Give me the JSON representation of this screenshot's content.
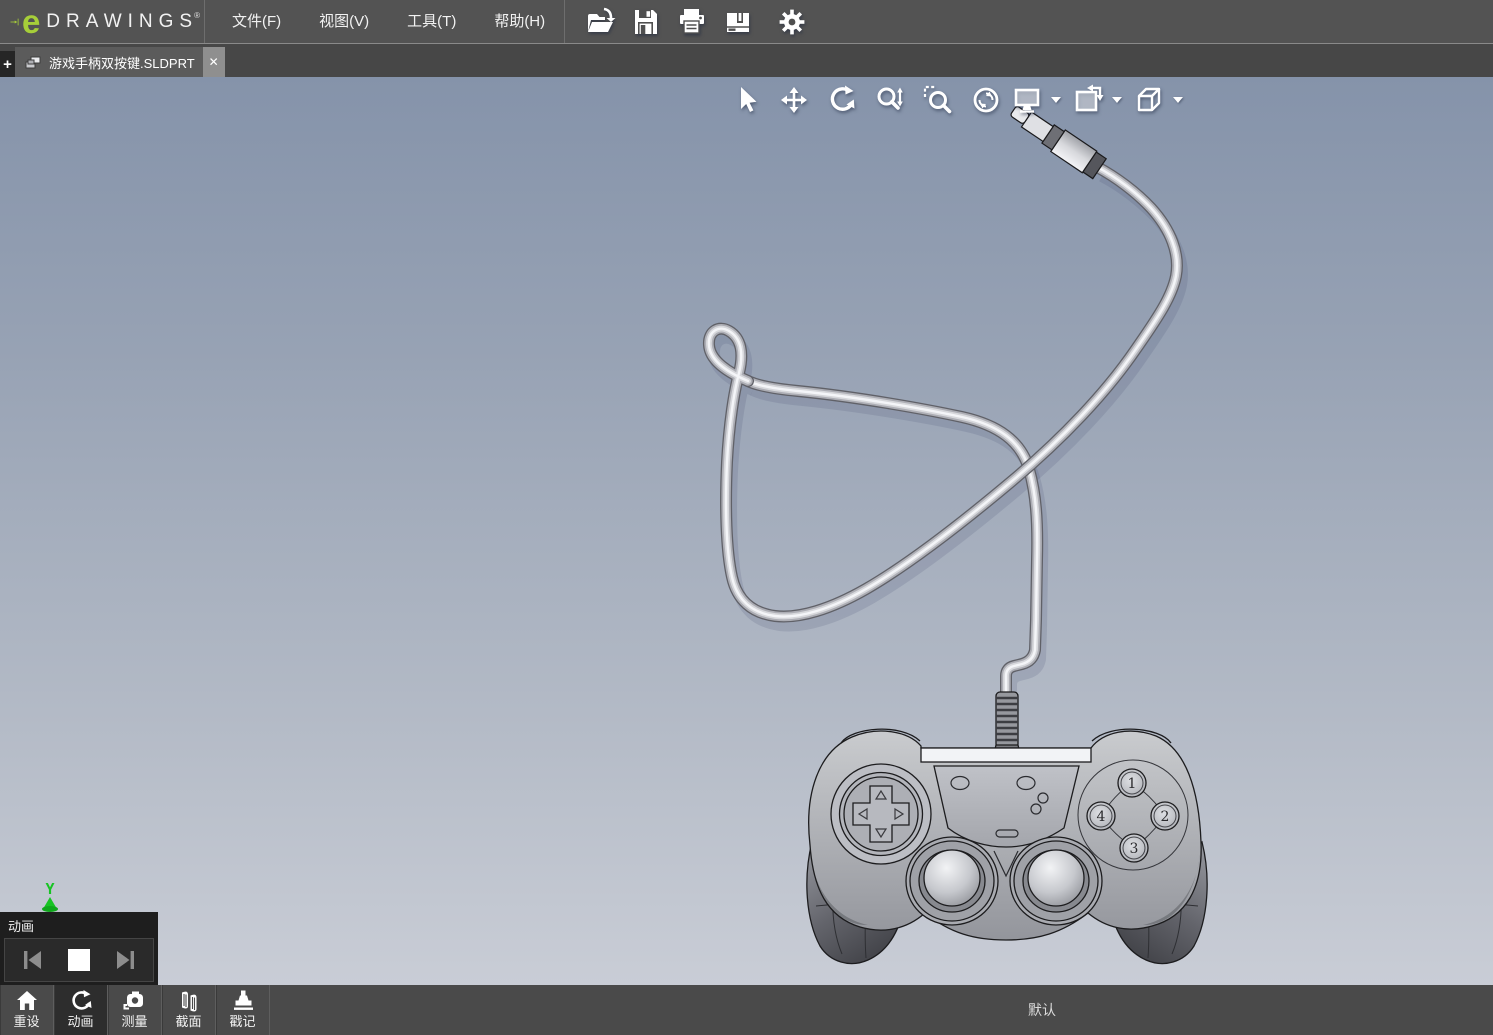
{
  "brand": {
    "logo_e": "e",
    "logo_name": "DRAWINGS",
    "logo_reg": "®",
    "logo_green": "#a6ce39"
  },
  "menu_bar": {
    "items": [
      {
        "label": "文件(F)"
      },
      {
        "label": "视图(V)"
      },
      {
        "label": "工具(T)"
      },
      {
        "label": "帮助(H)"
      }
    ],
    "icon_buttons": [
      {
        "icon": "open-file-icon"
      },
      {
        "icon": "save-icon"
      },
      {
        "icon": "print-icon"
      },
      {
        "icon": "publish-icon"
      },
      {
        "icon": "options-gear-icon"
      }
    ]
  },
  "tab_bar": {
    "new_tab_label": "+",
    "tabs": [
      {
        "title": "游戏手柄双按键.SLDPRT",
        "icon": "part-document-icon",
        "close_label": "✕",
        "active": true
      }
    ]
  },
  "viewport": {
    "background_top": "#8593aa",
    "background_bottom": "#c9cdd6",
    "float_toolbar": [
      {
        "icon": "select-cursor-icon"
      },
      {
        "icon": "pan-icon"
      },
      {
        "icon": "rotate-icon"
      },
      {
        "icon": "zoom-inout-icon"
      },
      {
        "icon": "zoom-area-icon"
      },
      {
        "icon": "zoom-fit-icon"
      },
      {
        "icon": "view-display-icon",
        "has_dropdown": true
      },
      {
        "icon": "named-views-icon",
        "has_dropdown": true
      },
      {
        "icon": "orientation-cube-icon",
        "has_dropdown": true
      }
    ],
    "triad": {
      "axis_label": "Y",
      "color": "#17c423"
    },
    "model": {
      "description": "gray CAD gamepad with coiled cable ending in an audio jack",
      "button_labels": [
        "1",
        "2",
        "3",
        "4"
      ]
    }
  },
  "animation_panel": {
    "title": "动画",
    "buttons": [
      {
        "icon": "previous-frame-icon"
      },
      {
        "icon": "stop-icon"
      },
      {
        "icon": "next-frame-icon"
      }
    ]
  },
  "status_bar": {
    "tools": [
      {
        "label": "重设",
        "icon": "home-icon",
        "active": false
      },
      {
        "label": "动画",
        "icon": "animation-icon",
        "active": true
      },
      {
        "label": "测量",
        "icon": "measure-icon",
        "active": false
      },
      {
        "label": "截面",
        "icon": "section-icon",
        "active": false
      },
      {
        "label": "戳记",
        "icon": "stamp-icon",
        "active": false
      }
    ],
    "configuration": "默认"
  }
}
